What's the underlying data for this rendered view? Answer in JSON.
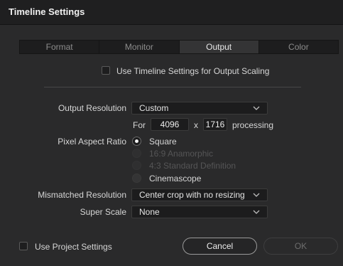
{
  "window": {
    "title": "Timeline Settings"
  },
  "tabs": [
    {
      "label": "Format",
      "active": false
    },
    {
      "label": "Monitor",
      "active": false
    },
    {
      "label": "Output",
      "active": true
    },
    {
      "label": "Color",
      "active": false
    }
  ],
  "output_scaling": {
    "label": "Use Timeline Settings for Output Scaling",
    "checked": false
  },
  "output_resolution": {
    "label": "Output Resolution",
    "value": "Custom",
    "for_label": "For",
    "width": "4096",
    "x_label": "x",
    "height": "1716",
    "processing_label": "processing"
  },
  "pixel_aspect_ratio": {
    "label": "Pixel Aspect Ratio",
    "options": [
      {
        "label": "Square",
        "state": "selected"
      },
      {
        "label": "16:9 Anamorphic",
        "state": "disabled"
      },
      {
        "label": "4:3 Standard Definition",
        "state": "disabled"
      },
      {
        "label": "Cinemascope",
        "state": "unselected"
      }
    ]
  },
  "mismatched_resolution": {
    "label": "Mismatched Resolution",
    "value": "Center crop with no resizing"
  },
  "super_scale": {
    "label": "Super Scale",
    "value": "None"
  },
  "footer": {
    "project_settings_label": "Use Project Settings",
    "project_settings_checked": false,
    "cancel_label": "Cancel",
    "ok_label": "OK"
  },
  "colors": {
    "background": "#2a2a2b",
    "titlebar": "#1f1f20",
    "field": "#1c1c1d"
  }
}
